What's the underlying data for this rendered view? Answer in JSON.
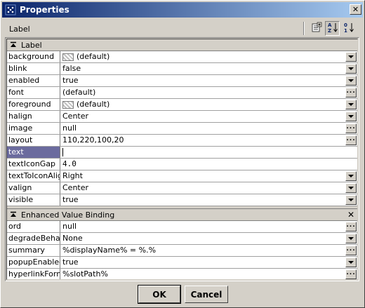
{
  "window": {
    "title": "Properties",
    "close_glyph": "✕",
    "app_icon": "grid-dots-icon"
  },
  "header": {
    "object_label": "Label",
    "toolbar": [
      {
        "name": "add-property-icon"
      },
      {
        "name": "sort-alpha-icon",
        "pressed": true
      },
      {
        "name": "sort-numeric-icon"
      }
    ]
  },
  "sections": [
    {
      "title": "Label",
      "rows": [
        {
          "name": "background",
          "value": "(default)",
          "swatch": true,
          "control": "dropdown"
        },
        {
          "name": "blink",
          "value": "false",
          "control": "dropdown"
        },
        {
          "name": "enabled",
          "value": "true",
          "control": "dropdown"
        },
        {
          "name": "font",
          "value": "(default)",
          "control": "ellipsis"
        },
        {
          "name": "foreground",
          "value": "(default)",
          "swatch": true,
          "control": "dropdown"
        },
        {
          "name": "halign",
          "value": "Center",
          "control": "dropdown"
        },
        {
          "name": "image",
          "value": "null",
          "control": "ellipsis"
        },
        {
          "name": "layout",
          "value": "110,220,100,20",
          "control": "ellipsis"
        },
        {
          "name": "text",
          "value": "",
          "selected": true,
          "control": "none"
        },
        {
          "name": "textIconGap",
          "value": "4.0",
          "mono": true,
          "control": "none"
        },
        {
          "name": "textToIconAlign",
          "value": "Right",
          "control": "dropdown"
        },
        {
          "name": "valign",
          "value": "Center",
          "control": "dropdown"
        },
        {
          "name": "visible",
          "value": "true",
          "control": "dropdown"
        }
      ]
    },
    {
      "title": "Enhanced Value Binding",
      "close_glyph": "✕",
      "rows": [
        {
          "name": "ord",
          "value": "null",
          "control": "ellipsis"
        },
        {
          "name": "degradeBehavior",
          "value": "None",
          "control": "dropdown"
        },
        {
          "name": "summary",
          "value": "%displayName% = %.%",
          "control": "ellipsis"
        },
        {
          "name": "popupEnabled",
          "value": "true",
          "control": "dropdown"
        },
        {
          "name": "hyperlinkFormat",
          "value": "%slotPath%",
          "control": "ellipsis"
        }
      ]
    }
  ],
  "footer": {
    "ok_label": "OK",
    "cancel_label": "Cancel"
  }
}
